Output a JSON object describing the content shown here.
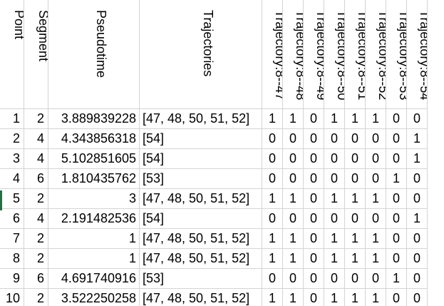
{
  "columns": [
    {
      "key": "point",
      "label": "Point"
    },
    {
      "key": "segment",
      "label": "Segment"
    },
    {
      "key": "pseudotime",
      "label": "Pseudotime"
    },
    {
      "key": "trajectories",
      "label": "Trajectories"
    },
    {
      "key": "t47",
      "label": "Trajectory:8--47"
    },
    {
      "key": "t48",
      "label": "Trajectory:8--48"
    },
    {
      "key": "t49",
      "label": "Trajectory:8--49"
    },
    {
      "key": "t50",
      "label": "Trajectory:8--50"
    },
    {
      "key": "t51",
      "label": "Trajectory:8--51"
    },
    {
      "key": "t52",
      "label": "Trajectory:8--52"
    },
    {
      "key": "t53",
      "label": "Trajectory:8--53"
    },
    {
      "key": "t54",
      "label": "Trajectory:8--54"
    }
  ],
  "rows": [
    [
      "1",
      "2",
      "3.889839228",
      "[47, 48, 50, 51, 52]",
      "1",
      "1",
      "0",
      "1",
      "1",
      "1",
      "0",
      "0"
    ],
    [
      "2",
      "4",
      "4.343856318",
      "[54]",
      "0",
      "0",
      "0",
      "0",
      "0",
      "0",
      "0",
      "1"
    ],
    [
      "3",
      "4",
      "5.102851605",
      "[54]",
      "0",
      "0",
      "0",
      "0",
      "0",
      "0",
      "0",
      "1"
    ],
    [
      "4",
      "6",
      "1.810435762",
      "[53]",
      "0",
      "0",
      "0",
      "0",
      "0",
      "0",
      "1",
      "0"
    ],
    [
      "5",
      "2",
      "3",
      "[47, 48, 50, 51, 52]",
      "1",
      "1",
      "0",
      "1",
      "1",
      "1",
      "0",
      "0"
    ],
    [
      "6",
      "4",
      "2.191482536",
      "[54]",
      "0",
      "0",
      "0",
      "0",
      "0",
      "0",
      "0",
      "1"
    ],
    [
      "7",
      "2",
      "1",
      "[47, 48, 50, 51, 52]",
      "1",
      "1",
      "0",
      "1",
      "1",
      "1",
      "0",
      "0"
    ],
    [
      "8",
      "2",
      "1",
      "[47, 48, 50, 51, 52]",
      "1",
      "1",
      "0",
      "1",
      "1",
      "1",
      "0",
      "0"
    ],
    [
      "9",
      "6",
      "4.691740916",
      "[53]",
      "0",
      "0",
      "0",
      "0",
      "0",
      "0",
      "1",
      "0"
    ],
    [
      "10",
      "2",
      "3.522250258",
      "[47, 48, 50, 51, 52]",
      "1",
      "1",
      "0",
      "1",
      "1",
      "1",
      "0",
      "0"
    ]
  ],
  "colors": {
    "gridline": "#d4d4d4",
    "selection": "#217346"
  }
}
